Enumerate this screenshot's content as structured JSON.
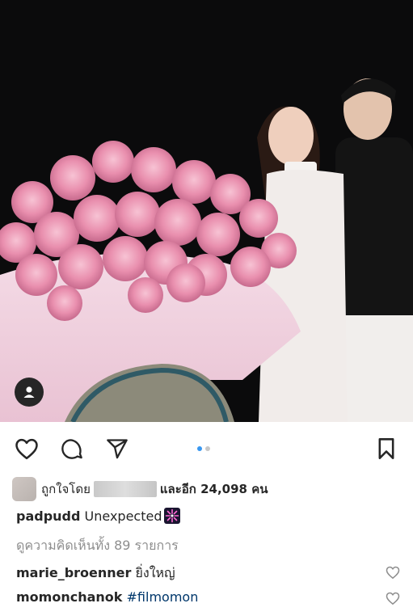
{
  "post": {
    "image_description_icon": "user-tag-icon",
    "carousel": {
      "count": 2,
      "active_index": 0
    }
  },
  "actions": {
    "like_icon": "heart-icon",
    "comment_icon": "comment-icon",
    "share_icon": "send-icon",
    "save_icon": "bookmark-icon"
  },
  "likes": {
    "prefix": "ถูกใจโดย",
    "suffix": "และอีก 24,098 คน"
  },
  "caption": {
    "username": "padpudd",
    "text": "Unexpected",
    "emoji_icon": "sparkle-firework-icon"
  },
  "view_comments": "ดูความคิดเห็นทั้ง 89 รายการ",
  "comments": [
    {
      "username": "marie_broenner",
      "text": "ยิ่งใหญ่"
    },
    {
      "username": "momonchanok",
      "text": "#filmomon"
    }
  ],
  "colors": {
    "link": "#00376b",
    "active_dot": "#3897f0",
    "muted": "#8e8e8e"
  }
}
